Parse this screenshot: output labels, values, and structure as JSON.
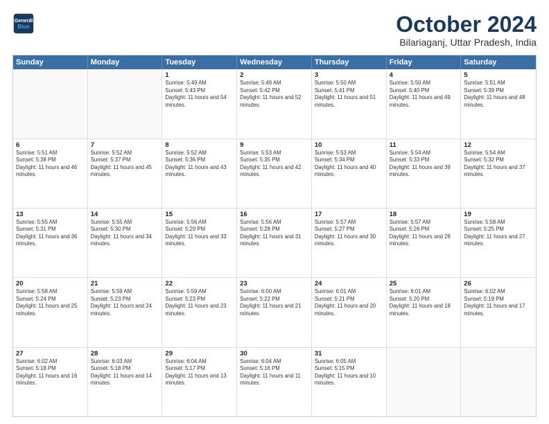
{
  "logo": {
    "line1": "General",
    "line2": "Blue"
  },
  "title": "October 2024",
  "subtitle": "Bilariaganj, Uttar Pradesh, India",
  "days": [
    "Sunday",
    "Monday",
    "Tuesday",
    "Wednesday",
    "Thursday",
    "Friday",
    "Saturday"
  ],
  "weeks": [
    [
      {
        "day": "",
        "info": ""
      },
      {
        "day": "",
        "info": ""
      },
      {
        "day": "1",
        "info": "Sunrise: 5:49 AM\nSunset: 5:43 PM\nDaylight: 11 hours and 54 minutes."
      },
      {
        "day": "2",
        "info": "Sunrise: 5:49 AM\nSunset: 5:42 PM\nDaylight: 11 hours and 52 minutes."
      },
      {
        "day": "3",
        "info": "Sunrise: 5:50 AM\nSunset: 5:41 PM\nDaylight: 11 hours and 51 minutes."
      },
      {
        "day": "4",
        "info": "Sunrise: 5:50 AM\nSunset: 5:40 PM\nDaylight: 11 hours and 49 minutes."
      },
      {
        "day": "5",
        "info": "Sunrise: 5:51 AM\nSunset: 5:39 PM\nDaylight: 11 hours and 48 minutes."
      }
    ],
    [
      {
        "day": "6",
        "info": "Sunrise: 5:51 AM\nSunset: 5:38 PM\nDaylight: 11 hours and 46 minutes."
      },
      {
        "day": "7",
        "info": "Sunrise: 5:52 AM\nSunset: 5:37 PM\nDaylight: 11 hours and 45 minutes."
      },
      {
        "day": "8",
        "info": "Sunrise: 5:52 AM\nSunset: 5:36 PM\nDaylight: 11 hours and 43 minutes."
      },
      {
        "day": "9",
        "info": "Sunrise: 5:53 AM\nSunset: 5:35 PM\nDaylight: 11 hours and 42 minutes."
      },
      {
        "day": "10",
        "info": "Sunrise: 5:53 AM\nSunset: 5:34 PM\nDaylight: 11 hours and 40 minutes."
      },
      {
        "day": "11",
        "info": "Sunrise: 5:54 AM\nSunset: 5:33 PM\nDaylight: 11 hours and 39 minutes."
      },
      {
        "day": "12",
        "info": "Sunrise: 5:54 AM\nSunset: 5:32 PM\nDaylight: 11 hours and 37 minutes."
      }
    ],
    [
      {
        "day": "13",
        "info": "Sunrise: 5:55 AM\nSunset: 5:31 PM\nDaylight: 11 hours and 36 minutes."
      },
      {
        "day": "14",
        "info": "Sunrise: 5:55 AM\nSunset: 5:30 PM\nDaylight: 11 hours and 34 minutes."
      },
      {
        "day": "15",
        "info": "Sunrise: 5:56 AM\nSunset: 5:29 PM\nDaylight: 11 hours and 33 minutes."
      },
      {
        "day": "16",
        "info": "Sunrise: 5:56 AM\nSunset: 5:28 PM\nDaylight: 11 hours and 31 minutes."
      },
      {
        "day": "17",
        "info": "Sunrise: 5:57 AM\nSunset: 5:27 PM\nDaylight: 11 hours and 30 minutes."
      },
      {
        "day": "18",
        "info": "Sunrise: 5:57 AM\nSunset: 5:26 PM\nDaylight: 11 hours and 28 minutes."
      },
      {
        "day": "19",
        "info": "Sunrise: 5:58 AM\nSunset: 5:25 PM\nDaylight: 11 hours and 27 minutes."
      }
    ],
    [
      {
        "day": "20",
        "info": "Sunrise: 5:58 AM\nSunset: 5:24 PM\nDaylight: 11 hours and 25 minutes."
      },
      {
        "day": "21",
        "info": "Sunrise: 5:59 AM\nSunset: 5:23 PM\nDaylight: 11 hours and 24 minutes."
      },
      {
        "day": "22",
        "info": "Sunrise: 5:59 AM\nSunset: 5:23 PM\nDaylight: 11 hours and 23 minutes."
      },
      {
        "day": "23",
        "info": "Sunrise: 6:00 AM\nSunset: 5:22 PM\nDaylight: 11 hours and 21 minutes."
      },
      {
        "day": "24",
        "info": "Sunrise: 6:01 AM\nSunset: 5:21 PM\nDaylight: 11 hours and 20 minutes."
      },
      {
        "day": "25",
        "info": "Sunrise: 6:01 AM\nSunset: 5:20 PM\nDaylight: 11 hours and 18 minutes."
      },
      {
        "day": "26",
        "info": "Sunrise: 6:02 AM\nSunset: 5:19 PM\nDaylight: 11 hours and 17 minutes."
      }
    ],
    [
      {
        "day": "27",
        "info": "Sunrise: 6:02 AM\nSunset: 5:18 PM\nDaylight: 11 hours and 16 minutes."
      },
      {
        "day": "28",
        "info": "Sunrise: 6:03 AM\nSunset: 5:18 PM\nDaylight: 11 hours and 14 minutes."
      },
      {
        "day": "29",
        "info": "Sunrise: 6:04 AM\nSunset: 5:17 PM\nDaylight: 11 hours and 13 minutes."
      },
      {
        "day": "30",
        "info": "Sunrise: 6:04 AM\nSunset: 5:16 PM\nDaylight: 11 hours and 11 minutes."
      },
      {
        "day": "31",
        "info": "Sunrise: 6:05 AM\nSunset: 5:15 PM\nDaylight: 11 hours and 10 minutes."
      },
      {
        "day": "",
        "info": ""
      },
      {
        "day": "",
        "info": ""
      }
    ]
  ]
}
